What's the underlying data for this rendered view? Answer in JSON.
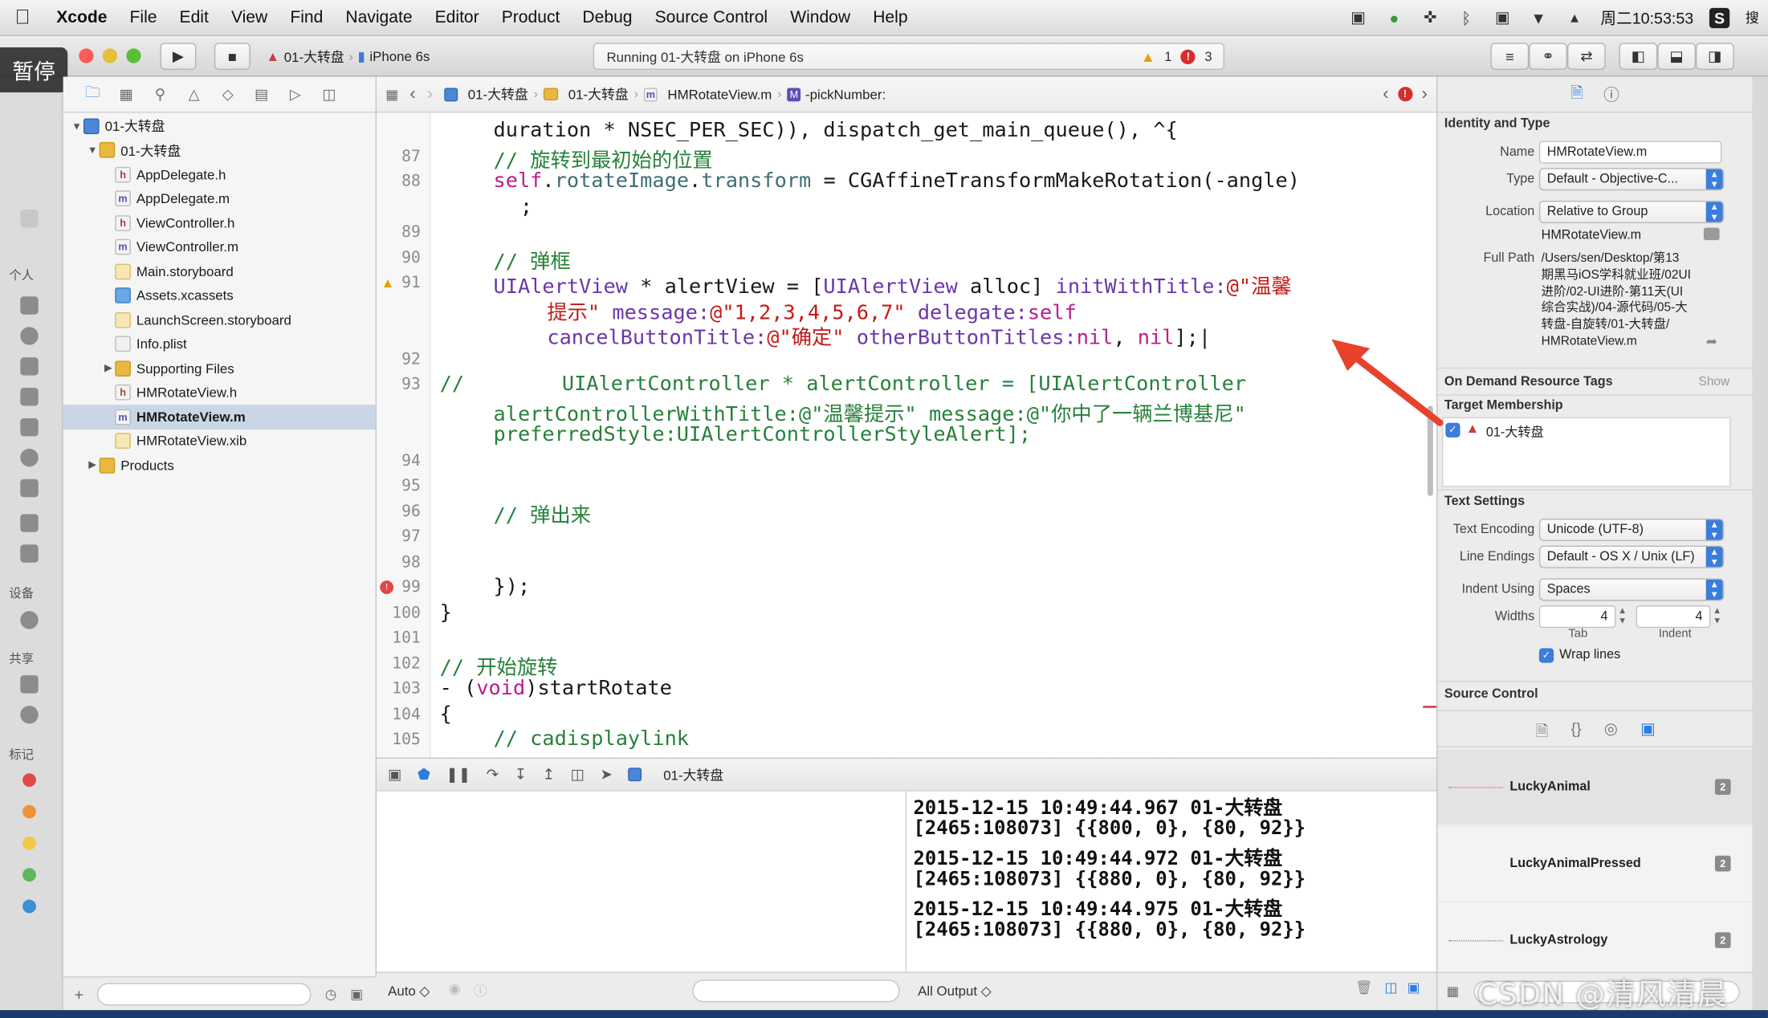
{
  "menubar": {
    "app_name": "Xcode",
    "items": [
      "File",
      "Edit",
      "View",
      "Find",
      "Navigate",
      "Editor",
      "Product",
      "Debug",
      "Source Control",
      "Window",
      "Help"
    ],
    "clock": "周二10:53:53",
    "search_tail": "搜"
  },
  "toolbar": {
    "scheme": "01-大转盘",
    "device": "iPhone 6s",
    "status": "Running 01-大转盘 on iPhone 6s",
    "warnings": "1",
    "errors": "3"
  },
  "overlay": {
    "pause_label": "暂停"
  },
  "dock": {
    "labels": [
      "个人",
      "设备",
      "共享",
      "标记"
    ],
    "tag_colors": [
      "#e24a4a",
      "#f0923a",
      "#f2c84b",
      "#5cb85c",
      "#3d8fd6"
    ]
  },
  "navigator": {
    "rows": [
      {
        "label": "01-大转盘",
        "icon": "proj",
        "indent": 0,
        "disc": "▼",
        "selected": false
      },
      {
        "label": "01-大转盘",
        "icon": "folder",
        "indent": 1,
        "disc": "▼",
        "selected": false
      },
      {
        "label": "AppDelegate.h",
        "icon": "h",
        "indent": 2,
        "disc": "",
        "selected": false
      },
      {
        "label": "AppDelegate.m",
        "icon": "m",
        "indent": 2,
        "disc": "",
        "selected": false
      },
      {
        "label": "ViewController.h",
        "icon": "h",
        "indent": 2,
        "disc": "",
        "selected": false
      },
      {
        "label": "ViewController.m",
        "icon": "m",
        "indent": 2,
        "disc": "",
        "selected": false
      },
      {
        "label": "Main.storyboard",
        "icon": "sb",
        "indent": 2,
        "disc": "",
        "selected": false
      },
      {
        "label": "Assets.xcassets",
        "icon": "assets",
        "indent": 2,
        "disc": "",
        "selected": false
      },
      {
        "label": "LaunchScreen.storyboard",
        "icon": "sb",
        "indent": 2,
        "disc": "",
        "selected": false
      },
      {
        "label": "Info.plist",
        "icon": "plist",
        "indent": 2,
        "disc": "",
        "selected": false
      },
      {
        "label": "Supporting Files",
        "icon": "folder",
        "indent": 2,
        "disc": "▶",
        "selected": false
      },
      {
        "label": "HMRotateView.h",
        "icon": "h",
        "indent": 2,
        "disc": "",
        "selected": false
      },
      {
        "label": "HMRotateView.m",
        "icon": "m",
        "indent": 2,
        "disc": "",
        "selected": true
      },
      {
        "label": "HMRotateView.xib",
        "icon": "xib",
        "indent": 2,
        "disc": "",
        "selected": false
      },
      {
        "label": "Products",
        "icon": "folder",
        "indent": 1,
        "disc": "▶",
        "selected": false
      }
    ]
  },
  "jumpbar": {
    "project": "01-大转盘",
    "group": "01-大转盘",
    "file": "HMRotateView.m",
    "method": "-pickNumber:"
  },
  "editor": {
    "line_numbers": [
      {
        "n": "87",
        "row": 1,
        "marker": ""
      },
      {
        "n": "88",
        "row": 2,
        "marker": ""
      },
      {
        "n": "89",
        "row": 4,
        "marker": ""
      },
      {
        "n": "90",
        "row": 5,
        "marker": ""
      },
      {
        "n": "91",
        "row": 6,
        "marker": "warn"
      },
      {
        "n": "92",
        "row": 9,
        "marker": ""
      },
      {
        "n": "93",
        "row": 10,
        "marker": ""
      },
      {
        "n": "94",
        "row": 13,
        "marker": ""
      },
      {
        "n": "95",
        "row": 14,
        "marker": ""
      },
      {
        "n": "96",
        "row": 15,
        "marker": ""
      },
      {
        "n": "97",
        "row": 16,
        "marker": ""
      },
      {
        "n": "98",
        "row": 17,
        "marker": ""
      },
      {
        "n": "99",
        "row": 18,
        "marker": "err"
      },
      {
        "n": "100",
        "row": 19,
        "marker": ""
      },
      {
        "n": "101",
        "row": 20,
        "marker": ""
      },
      {
        "n": "102",
        "row": 21,
        "marker": ""
      },
      {
        "n": "103",
        "row": 22,
        "marker": ""
      },
      {
        "n": "104",
        "row": 23,
        "marker": ""
      },
      {
        "n": "105",
        "row": 24,
        "marker": ""
      }
    ],
    "lines": [
      {
        "row": 0,
        "indent": 4,
        "parts": [
          [
            "",
            "duration * NSEC_PER_SEC)), dispatch_get_main_queue(), ^{"
          ]
        ]
      },
      {
        "row": 1,
        "indent": 4,
        "parts": [
          [
            "cm",
            "// 旋转到最初始的位置"
          ]
        ]
      },
      {
        "row": 2,
        "indent": 4,
        "parts": [
          [
            "kw",
            "self"
          ],
          [
            "",
            "."
          ],
          [
            "fn",
            "rotateImage"
          ],
          [
            "",
            "."
          ],
          [
            "fn",
            "transform"
          ],
          [
            "",
            " = CGAffineTransformMakeRotation(-angle)"
          ]
        ]
      },
      {
        "row": 3,
        "indent": 6,
        "parts": [
          [
            "",
            ";"
          ]
        ]
      },
      {
        "row": 5,
        "indent": 4,
        "parts": [
          [
            "cm",
            "// 弹框"
          ]
        ]
      },
      {
        "row": 6,
        "indent": 4,
        "parts": [
          [
            "cls",
            "UIAlertView"
          ],
          [
            "",
            " * alertView = ["
          ],
          [
            "cls",
            "UIAlertView"
          ],
          [
            "",
            " alloc] "
          ],
          [
            "cls",
            "initWithTitle:"
          ],
          [
            "str",
            "@\"温馨"
          ]
        ]
      },
      {
        "row": 7,
        "indent": 8,
        "parts": [
          [
            "str",
            "提示\""
          ],
          [
            "",
            " "
          ],
          [
            "cls",
            "message:"
          ],
          [
            "str",
            "@\"1,2,3,4,5,6,7\""
          ],
          [
            "",
            " "
          ],
          [
            "cls",
            "delegate:"
          ],
          [
            "kw",
            "self"
          ]
        ]
      },
      {
        "row": 8,
        "indent": 8,
        "parts": [
          [
            "cls",
            "cancelButtonTitle:"
          ],
          [
            "str",
            "@\"确定\""
          ],
          [
            "",
            " "
          ],
          [
            "cls",
            "otherButtonTitles:"
          ],
          [
            "kw",
            "nil"
          ],
          [
            "",
            ", "
          ],
          [
            "kw",
            "nil"
          ],
          [
            "",
            "];|"
          ]
        ]
      },
      {
        "row": 10,
        "indent": 0,
        "parts": [
          [
            "cm",
            "//        UIAlertController * alertController = [UIAlertController"
          ]
        ]
      },
      {
        "row": 11,
        "indent": 4,
        "parts": [
          [
            "cm",
            "alertControllerWithTitle:@\"温馨提示\" message:@\"你中了一辆兰博基尼\""
          ]
        ]
      },
      {
        "row": 12,
        "indent": 4,
        "parts": [
          [
            "cm",
            "preferredStyle:UIAlertControllerStyleAlert];"
          ]
        ]
      },
      {
        "row": 15,
        "indent": 4,
        "parts": [
          [
            "cm",
            "// 弹出来"
          ]
        ]
      },
      {
        "row": 18,
        "indent": 4,
        "parts": [
          [
            "",
            "});"
          ]
        ]
      },
      {
        "row": 19,
        "indent": 0,
        "parts": [
          [
            "",
            "}"
          ]
        ]
      },
      {
        "row": 21,
        "indent": 0,
        "parts": [
          [
            "cm",
            "// 开始旋转"
          ]
        ]
      },
      {
        "row": 22,
        "indent": 0,
        "parts": [
          [
            "",
            "- ("
          ],
          [
            "kw",
            "void"
          ],
          [
            "",
            ")startRotate"
          ]
        ]
      },
      {
        "row": 23,
        "indent": 0,
        "parts": [
          [
            "",
            "{"
          ]
        ]
      },
      {
        "row": 24,
        "indent": 4,
        "parts": [
          [
            "cm",
            "// cadisplaylink"
          ]
        ]
      }
    ]
  },
  "debug": {
    "target": "01-大转盘",
    "vars_mode": "Auto ◇",
    "output_mode": "All Output ◇",
    "console": [
      "2015-12-15 10:49:44.967 01-大转盘",
      "[2465:108073] {{800, 0}, {80, 92}}",
      "2015-12-15 10:49:44.972 01-大转盘",
      "[2465:108073] {{880, 0}, {80, 92}}",
      "2015-12-15 10:49:44.975 01-大转盘",
      "[2465:108073] {{880, 0}, {80, 92}}"
    ]
  },
  "inspector": {
    "identity": {
      "title": "Identity and Type",
      "name_label": "Name",
      "name": "HMRotateView.m",
      "type_label": "Type",
      "type": "Default - Objective-C...",
      "location_label": "Location",
      "location": "Relative to Group",
      "location_file": "HMRotateView.m",
      "fullpath_label": "Full Path",
      "fullpath_lines": [
        "/Users/sen/Desktop/第13",
        "期黑马iOS学科就业班/02UI",
        "进阶/02-UI进阶-第11天(UI",
        "综合实战)/04-源代码/05-大",
        "转盘-自旋转/01-大转盘/",
        "HMRotateView.m"
      ]
    },
    "ondemand": {
      "title": "On Demand Resource Tags",
      "show": "Show"
    },
    "membership": {
      "title": "Target Membership",
      "target": "01-大转盘"
    },
    "text": {
      "title": "Text Settings",
      "encoding_label": "Text Encoding",
      "encoding": "Unicode (UTF-8)",
      "endings_label": "Line Endings",
      "endings": "Default - OS X / Unix (LF)",
      "indent_label": "Indent Using",
      "indent": "Spaces",
      "widths_label": "Widths",
      "tab_value": "4",
      "indent_value": "4",
      "tab_caption": "Tab",
      "indent_caption": "Indent",
      "wrap_label": "Wrap lines"
    },
    "source_control": {
      "title": "Source Control"
    },
    "library": [
      "LuckyAnimal",
      "LuckyAnimalPressed",
      "LuckyAstrology"
    ]
  },
  "watermark": "CSDN @清风清晨",
  "colors": {
    "accent": "#2c7ce0",
    "arrow": "#e8412c"
  }
}
